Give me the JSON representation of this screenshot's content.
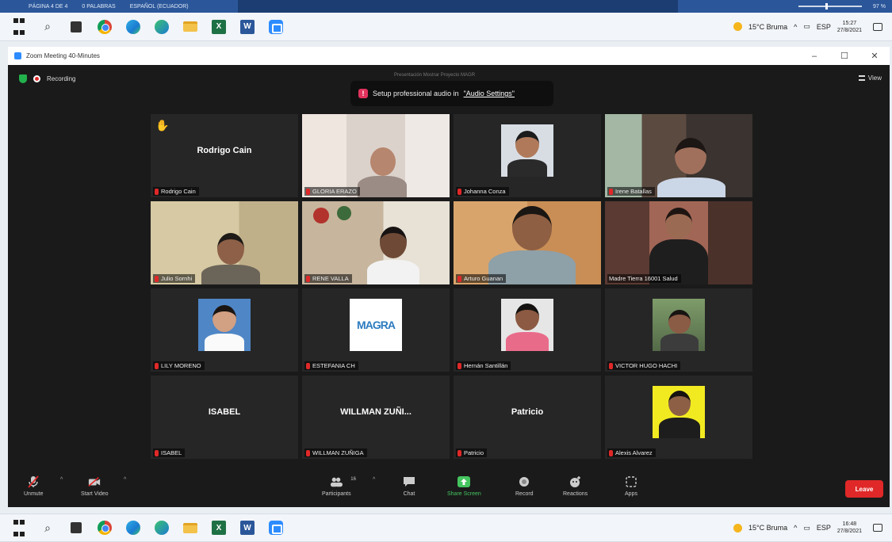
{
  "wordbar": {
    "page": "PÁGINA 4 DE 4",
    "words": "0 PALABRAS",
    "spanish": "ESPAÑOL (ECUADOR)",
    "zoom": "97 %"
  },
  "taskbar_top": {
    "weather": "15°C Bruma",
    "lang": "ESP",
    "time": "15:27",
    "date": "27/8/2021"
  },
  "taskbar_bottom": {
    "weather": "15°C Bruma",
    "lang": "ESP",
    "time": "16:48",
    "date": "27/8/2021"
  },
  "window": {
    "title": "Zoom Meeting 40-Minutes",
    "minimize": "–",
    "maximize": "☐",
    "close": "✕"
  },
  "meeting": {
    "recording_label": "Recording",
    "talking_label": "Presentación Mostrar Proyecto MAGR",
    "view_label": "View",
    "audio_tip_prefix": "Setup professional audio in ",
    "audio_tip_link": "\"Audio Settings\""
  },
  "participants": [
    {
      "name": "Rodrigo Cain",
      "big": "Rodrigo Cain",
      "hand": true
    },
    {
      "name": "GLORIA ERAZO"
    },
    {
      "name": "Johanna Conza"
    },
    {
      "name": "Irene Batallas"
    },
    {
      "name": "Julio Sornhi"
    },
    {
      "name": "RENE VALLA"
    },
    {
      "name": "Arturo Guanan"
    },
    {
      "name": "Madre Tierra 16001 Salud",
      "active": true
    },
    {
      "name": "LILY MORENO"
    },
    {
      "name": "ESTEFANIA CH"
    },
    {
      "name": "Hernán Santillán"
    },
    {
      "name": "VICTOR HUGO HACHI"
    },
    {
      "name": "ISABEL",
      "big": "ISABEL"
    },
    {
      "name": "WILLMAN ZUÑIGA",
      "big": "WILLMAN ZUÑI..."
    },
    {
      "name": "Patricio",
      "big": "Patricio"
    },
    {
      "name": "Alexis Alvarez"
    }
  ],
  "controls": {
    "unmute": "Unmute",
    "start_video": "Start Video",
    "participants": "Participants",
    "participants_count": "16",
    "chat": "Chat",
    "share_screen": "Share Screen",
    "record": "Record",
    "reactions": "Reactions",
    "apps": "Apps",
    "leave": "Leave"
  },
  "logo_text": "MAGRA"
}
